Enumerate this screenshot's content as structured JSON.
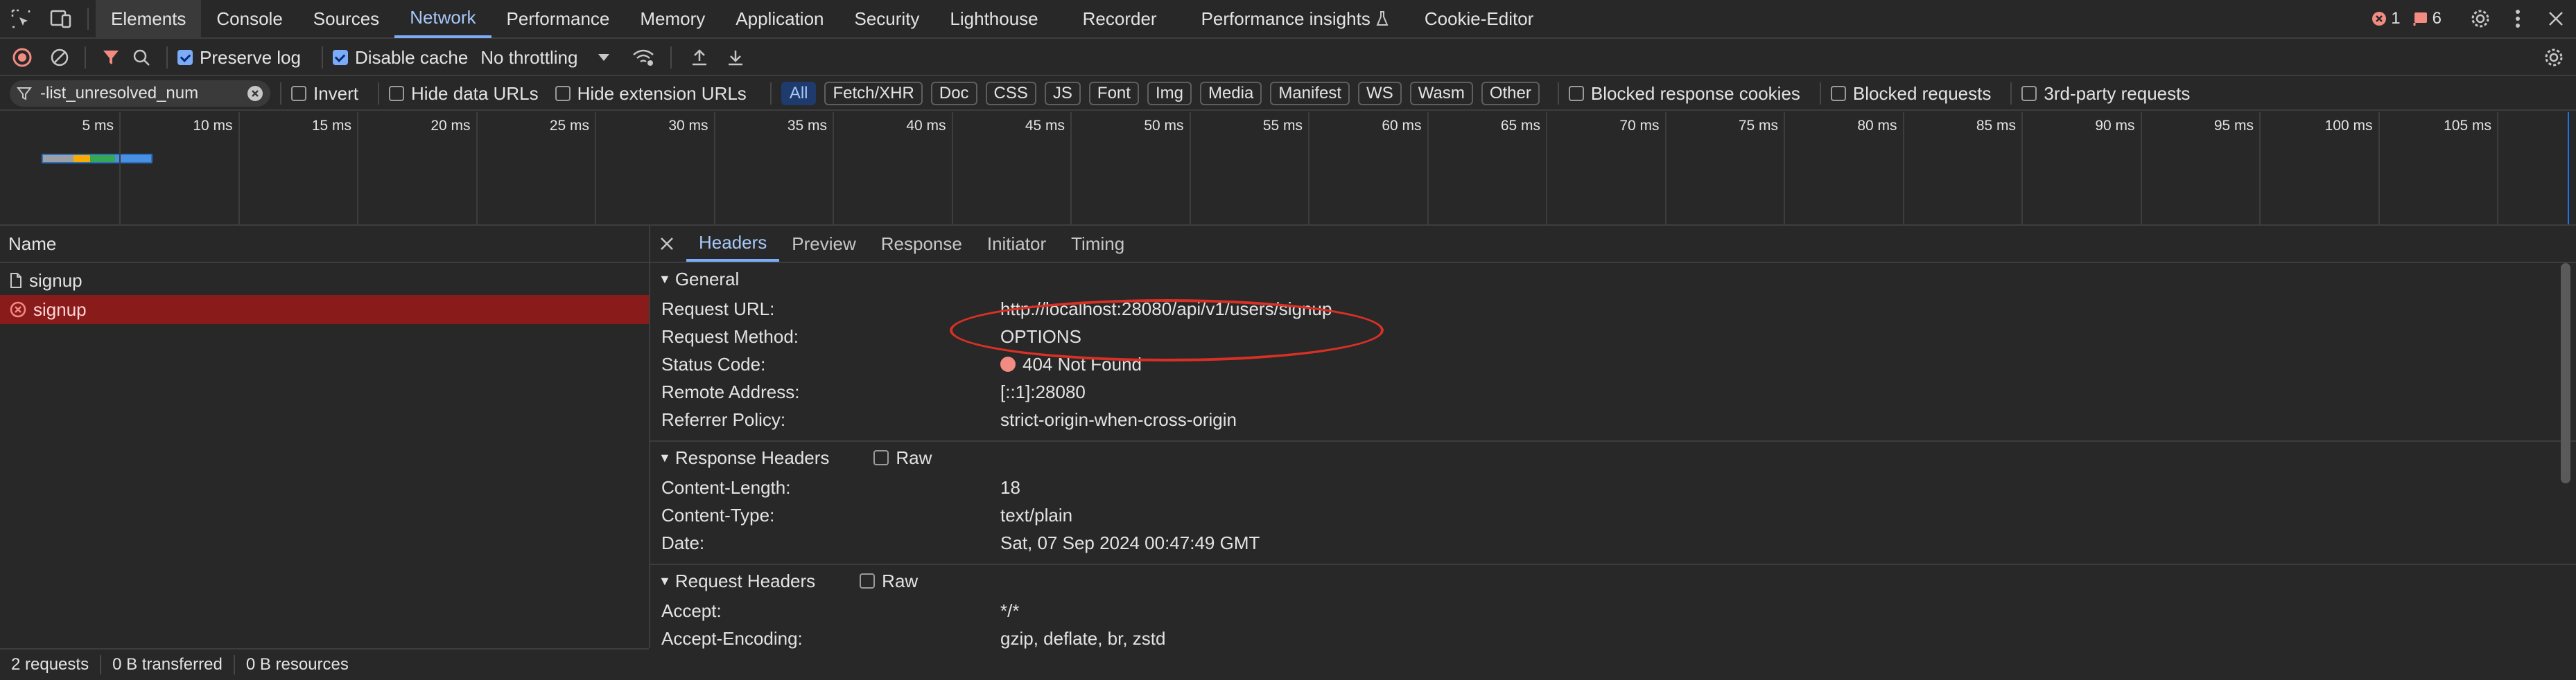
{
  "top_tabs": [
    "Elements",
    "Console",
    "Sources",
    "Network",
    "Performance",
    "Memory",
    "Application",
    "Security",
    "Lighthouse",
    "Recorder",
    "Performance insights",
    "Cookie-Editor"
  ],
  "badges": {
    "errors": "1",
    "issues": "6"
  },
  "toolbar": {
    "preserve_log": "Preserve log",
    "disable_cache": "Disable cache",
    "throttling": "No throttling"
  },
  "filter": {
    "value": "-list_unresolved_num",
    "invert": "Invert",
    "hide_data_urls": "Hide data URLs",
    "hide_extension_urls": "Hide extension URLs",
    "types": [
      "All",
      "Fetch/XHR",
      "Doc",
      "CSS",
      "JS",
      "Font",
      "Img",
      "Media",
      "Manifest",
      "WS",
      "Wasm",
      "Other"
    ],
    "blocked_response_cookies": "Blocked response cookies",
    "blocked_requests": "Blocked requests",
    "third_party": "3rd-party requests"
  },
  "timeline": {
    "ticks": [
      "5 ms",
      "10 ms",
      "15 ms",
      "20 ms",
      "25 ms",
      "30 ms",
      "35 ms",
      "40 ms",
      "45 ms",
      "50 ms",
      "55 ms",
      "60 ms",
      "65 ms",
      "70 ms",
      "75 ms",
      "80 ms",
      "85 ms",
      "90 ms",
      "95 ms",
      "100 ms",
      "105 ms"
    ]
  },
  "requests": {
    "column": "Name",
    "rows": [
      {
        "name": "signup",
        "status": "ok"
      },
      {
        "name": "signup",
        "status": "error"
      }
    ]
  },
  "detail_tabs": [
    "Headers",
    "Preview",
    "Response",
    "Initiator",
    "Timing"
  ],
  "general": {
    "title": "General",
    "rows": [
      {
        "k": "Request URL:",
        "v": "http://localhost:28080/api/v1/users/signup"
      },
      {
        "k": "Request Method:",
        "v": "OPTIONS"
      },
      {
        "k": "Status Code:",
        "v": "404 Not Found"
      },
      {
        "k": "Remote Address:",
        "v": "[::1]:28080"
      },
      {
        "k": "Referrer Policy:",
        "v": "strict-origin-when-cross-origin"
      }
    ]
  },
  "response_headers": {
    "title": "Response Headers",
    "raw": "Raw",
    "rows": [
      {
        "k": "Content-Length:",
        "v": "18"
      },
      {
        "k": "Content-Type:",
        "v": "text/plain"
      },
      {
        "k": "Date:",
        "v": "Sat, 07 Sep 2024 00:47:49 GMT"
      }
    ]
  },
  "request_headers": {
    "title": "Request Headers",
    "raw": "Raw",
    "rows": [
      {
        "k": "Accept:",
        "v": "*/*"
      },
      {
        "k": "Accept-Encoding:",
        "v": "gzip, deflate, br, zstd"
      }
    ]
  },
  "status": {
    "requests": "2 requests",
    "transferred": "0 B transferred",
    "resources": "0 B resources"
  }
}
